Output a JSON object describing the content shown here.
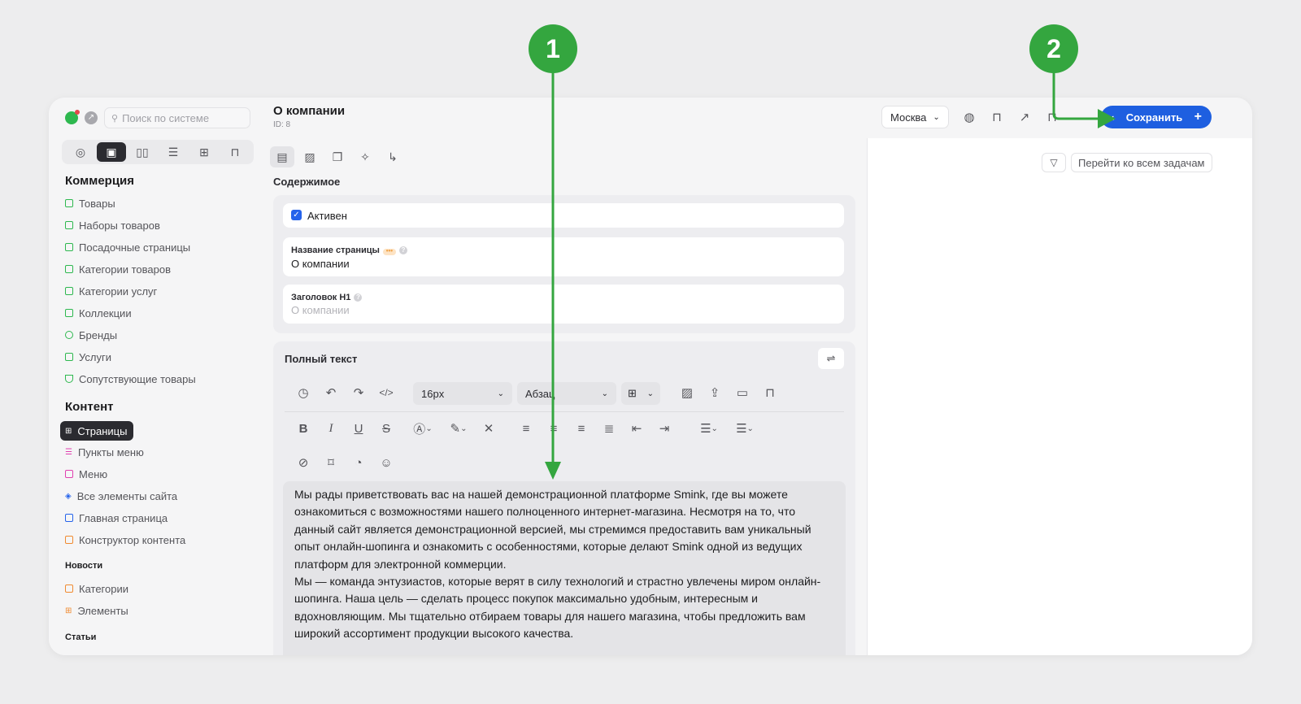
{
  "search": {
    "placeholder": "Поиск по системе"
  },
  "sidebar": {
    "sections": [
      {
        "title": "Коммерция"
      },
      {
        "title": "Контент"
      }
    ],
    "commerce_items": [
      {
        "label": "Товары"
      },
      {
        "label": "Наборы товаров"
      },
      {
        "label": "Посадочные страницы"
      },
      {
        "label": "Категории товаров"
      },
      {
        "label": "Категории услуг"
      },
      {
        "label": "Коллекции"
      },
      {
        "label": "Бренды"
      },
      {
        "label": "Услуги"
      },
      {
        "label": "Сопутствующие товары"
      }
    ],
    "content_items": [
      {
        "label": "Страницы"
      },
      {
        "label": "Пункты меню"
      },
      {
        "label": "Меню"
      },
      {
        "label": "Все элементы сайта"
      },
      {
        "label": "Главная страница"
      },
      {
        "label": "Конструктор контента"
      }
    ],
    "news": {
      "title": "Новости",
      "items": [
        {
          "label": "Категории"
        },
        {
          "label": "Элементы"
        }
      ]
    },
    "articles": {
      "title": "Статьи"
    }
  },
  "page": {
    "title": "О компании",
    "id": "ID: 8"
  },
  "content": {
    "label": "Содержимое",
    "active_label": "Активен",
    "name_label": "Название страницы",
    "name_value": "О компании",
    "h1_label": "Заголовок H1",
    "h1_placeholder": "О компании"
  },
  "editor": {
    "title": "Полный текст",
    "font_size": "16px",
    "block_type": "Абзац",
    "text": "Мы рады приветствовать вас на нашей демонстрационной платформе Smink, где вы можете ознакомиться с возможностями нашего полноценного интернет-магазина.  Несмотря на то, что данный сайт является демонстрационной версией, мы стремимся предоставить вам уникальный опыт онлайн-шопинга и ознакомить с особенностями, которые делают Smink одной из ведущих платформ для электронной коммерции.",
    "text2": "Мы — команда энтузиастов, которые верят в силу технологий и страстно увлечены миром онлайн-шопинга.  Наша цель — сделать процесс покупок максимально удобным, интересным и вдохновляющим.  Мы тщательно отбираем товары для нашего магазина, чтобы предложить вам широкий ассортимент продукции высокого качества."
  },
  "header": {
    "city": "Москва",
    "save_label": "Сохранить"
  },
  "tasks": {
    "all_tasks_label": "Перейти ко всем задачам"
  },
  "annotations": {
    "badge1": "1",
    "badge2": "2",
    "color": "#34a63f"
  },
  "colors": {
    "accent": "#1e5fe0",
    "annotation": "#34a63f"
  }
}
